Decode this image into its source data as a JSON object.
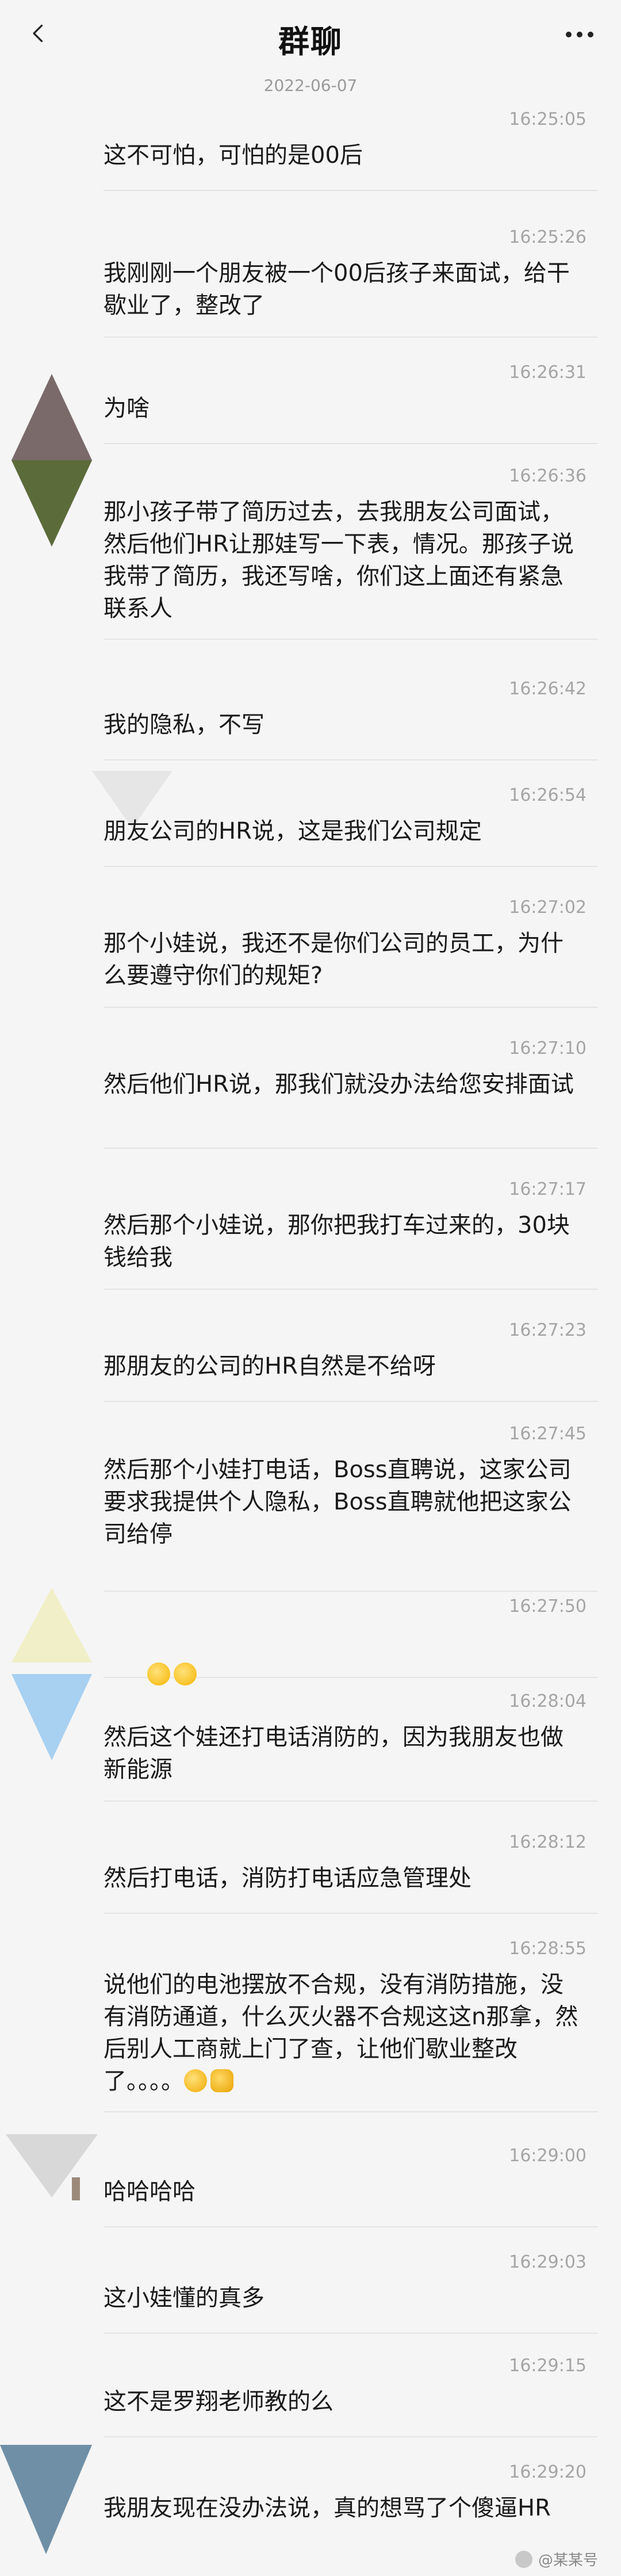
{
  "header": {
    "title": "群聊",
    "back_icon": "back-arrow-icon",
    "more_icon": "more-dots-icon"
  },
  "date_separator": "2022-06-07",
  "messages": [
    {
      "time": "16:25:05",
      "text": "这不可怕，可怕的是00后"
    },
    {
      "time": "16:25:26",
      "text": "我刚刚一个朋友被一个00后孩子来面试，给干歇业了，整改了"
    },
    {
      "time": "16:26:31",
      "text": "为啥"
    },
    {
      "time": "16:26:36",
      "text": "那小孩子带了简历过去，去我朋友公司面试，然后他们HR让那娃写一下表，情况。那孩子说我带了简历，我还写啥，你们这上面还有紧急联系人"
    },
    {
      "time": "16:26:42",
      "text": "我的隐私，不写"
    },
    {
      "time": "16:26:54",
      "text": "朋友公司的HR说，这是我们公司规定"
    },
    {
      "time": "16:27:02",
      "text": "那个小娃说，我还不是你们公司的员工，为什么要遵守你们的规矩?"
    },
    {
      "time": "16:27:10",
      "text": "然后他们HR说，那我们就没办法给您安排面试"
    },
    {
      "time": "16:27:17",
      "text": "然后那个小娃说，那你把我打车过来的，30块钱给我"
    },
    {
      "time": "16:27:23",
      "text": "那朋友的公司的HR自然是不给呀"
    },
    {
      "time": "16:27:45",
      "text": "然后那个小娃打电话，Boss直聘说，这家公司要求我提供个人隐私，Boss直聘就他把这家公司给停"
    },
    {
      "time": "16:27:50",
      "text": ""
    },
    {
      "time": "16:28:04",
      "text": "然后这个娃还打电话消防的，因为我朋友也做新能源"
    },
    {
      "time": "16:28:12",
      "text": "然后打电话，消防打电话应急管理处"
    },
    {
      "time": "16:28:55",
      "text": "说他们的电池摆放不合规，没有消防措施，没有消防通道，什么灭火器不合规这这n那拿，然后别人工商就上门了查，让他们歇业整改了。。。。"
    },
    {
      "time": "16:29:00",
      "text": "哈哈哈哈"
    },
    {
      "time": "16:29:03",
      "text": "这小娃懂的真多"
    },
    {
      "time": "16:29:15",
      "text": "这不是罗翔老师教的么"
    },
    {
      "time": "16:29:20",
      "text": "我朋友现在没办法说，真的想骂了个傻逼HR"
    }
  ],
  "emojis": {
    "think": "thinking-face-emoji",
    "laugh": "laughing-face-emoji",
    "thumb": "thumbs-up-emoji"
  },
  "watermark": "@某某号"
}
